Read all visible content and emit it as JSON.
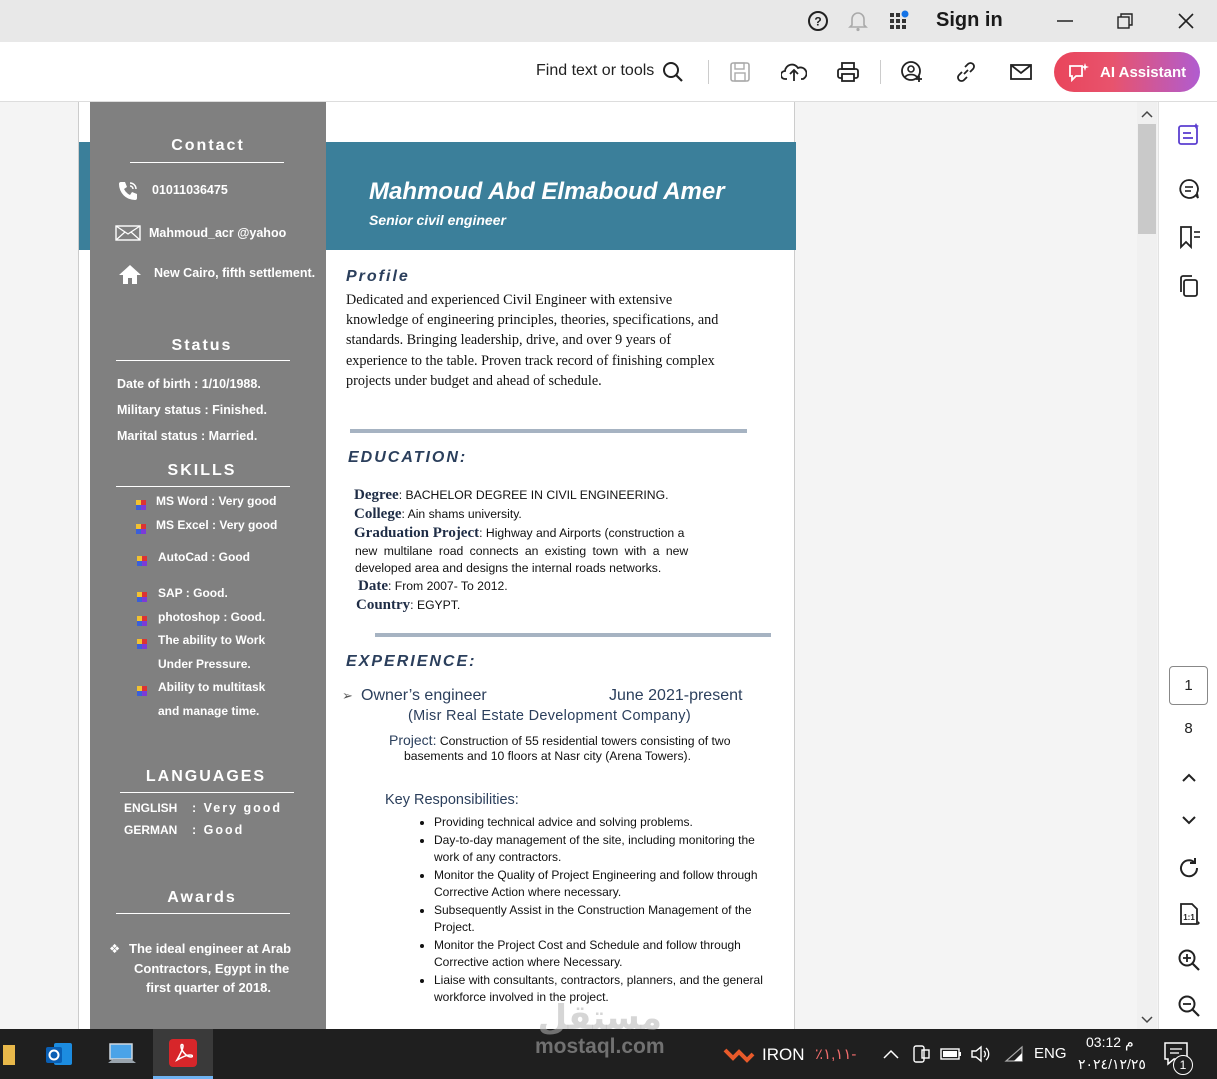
{
  "titlebar": {
    "sign_in": "Sign in"
  },
  "toolbar": {
    "find": "Find text or tools",
    "ai_assistant": "AI Assistant"
  },
  "cv": {
    "name": "Mahmoud Abd Elmaboud  Amer",
    "role": "Senior civil engineer",
    "contact": {
      "title": "Contact",
      "phone": "01011036475",
      "email": "Mahmoud_acr @yahoo",
      "address": "New Cairo, fifth settlement."
    },
    "status": {
      "title": "Status",
      "dob": "Date of birth    : 1/10/1988.",
      "military": "Military status : Finished.",
      "marital": "Marital status : Married."
    },
    "skills": {
      "title": "SKILLS",
      "items": [
        "MS Word : Very good",
        "MS Excel : Very good",
        "AutoCad  : Good",
        "SAP : Good.",
        "photoshop :  Good.",
        "The ability to Work",
        "Under Pressure.",
        "Ability to multitask",
        "and manage time."
      ]
    },
    "languages": {
      "title": "LANGUAGES",
      "english_label": "ENGLISH",
      "english_value": ":  Very good",
      "german_label": "GERMAN",
      "german_value": ":  Good"
    },
    "awards": {
      "title": "Awards",
      "line1": "The ideal engineer at Arab",
      "line2": "Contractors, Egypt in the",
      "line3": "first quarter of 2018."
    },
    "profile": {
      "title": "Profile",
      "lines": [
        "Dedicated and experienced Civil Engineer with extensive",
        "knowledge of engineering principles, theories, specifications, and",
        "standards. Bringing leadership, drive, and over 9 years of",
        "experience to the table. Proven track record of finishing complex",
        "projects under budget and ahead of schedule."
      ]
    },
    "education": {
      "title": "EDUCATION:",
      "degree_key": "Degree",
      "degree_val": ": BACHELOR DEGREE IN CIVIL ENGINEERING.",
      "college_key": "College",
      "college_val": ": Ain shams university.",
      "project_key": "Graduation Project",
      "project_val": ": Highway and Airports (construction a",
      "project_l2": "new multilane road connects an existing town with a new",
      "project_l3": "developed area and designs the internal roads networks.",
      "date_key": "Date",
      "date_val": ": From 2007- To 2012.",
      "country_key": "Country",
      "country_val": ": EGYPT."
    },
    "experience": {
      "title": "EXPERIENCE:",
      "job": "Owner’s engineer",
      "period": "June 2021-present",
      "company": "(Misr Real Estate Development Company)",
      "project_key": "Project:",
      "project_val": " Construction of  55 residential towers consisting of two",
      "project_l2": "basements and 10 floors at Nasr city (Arena Towers).",
      "resp_title": "Key Responsibilities:",
      "resp": [
        "Providing technical advice and solving problems.",
        "Day-to-day management of the site, including monitoring the work of any contractors.",
        "Monitor the Quality of Project Engineering and follow through Corrective Action where necessary.",
        "Subsequently Assist in the Construction Management of the Project.",
        "Monitor the Project Cost and Schedule and follow through Corrective action where Necessary.",
        "Liaise with consultants, contractors, planners, and the general workforce involved in the project."
      ]
    }
  },
  "navigator": {
    "current_page": "1",
    "total_pages": "8"
  },
  "taskbar": {
    "stock_name": "IRON",
    "stock_change": "٪١,١١-",
    "lang": "ENG",
    "time": "03:12 م",
    "date": "٢٠٢٤/١٢/٢٥",
    "notif_count": "1"
  },
  "watermark": {
    "line1": "مستقل",
    "line2": "mostaql.com"
  },
  "colors": {
    "sidebar": "#808080",
    "header_band": "#3b7f9a",
    "ai_gradient_start": "#e9455b",
    "ai_gradient_end": "#b05cd0"
  }
}
